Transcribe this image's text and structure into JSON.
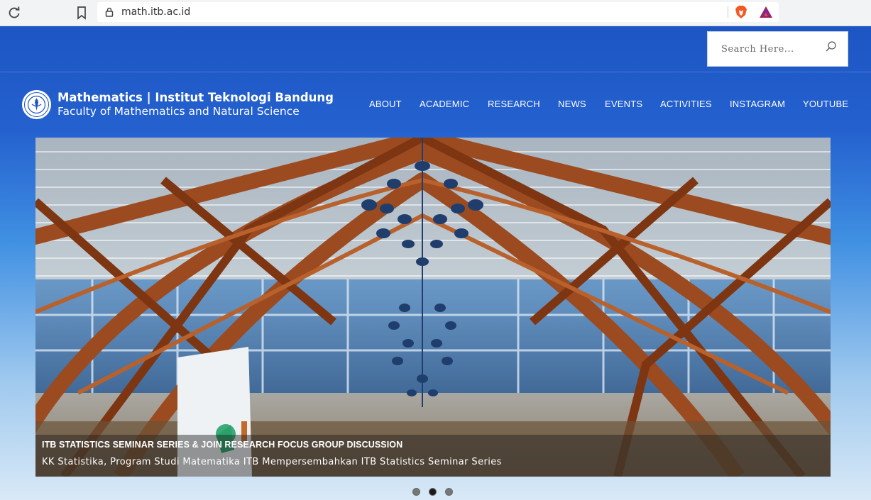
{
  "browser": {
    "url": "math.itb.ac.id",
    "icons": [
      "reload-icon",
      "bookmark-icon",
      "lock-icon",
      "brave-shield-icon",
      "bat-rewards-icon"
    ]
  },
  "header": {
    "search_placeholder": "Search Here...",
    "brand_title": "Mathematics | Institut Teknologi Bandung",
    "brand_subtitle": "Faculty of Mathematics and Natural Science",
    "nav": [
      "ABOUT",
      "ACADEMIC",
      "RESEARCH",
      "NEWS",
      "EVENTS",
      "ACTIVITIES",
      "INSTAGRAM",
      "YOUTUBE"
    ]
  },
  "slider": {
    "caption_title": "ITB STATISTICS SEMINAR SERIES & JOIN RESEARCH FOCUS GROUP DISCUSSION",
    "caption_text": "KK Statistika, Program Studi Matematika ITB Mempersembahkan ITB Statistics Seminar Series",
    "slide_count": 3,
    "active_slide": 2
  },
  "colors": {
    "header_blue": "#1d55c4",
    "caption_overlay": "#1e1e1e",
    "active_dot": "#1a1a1a",
    "inactive_dot": "#777777"
  }
}
